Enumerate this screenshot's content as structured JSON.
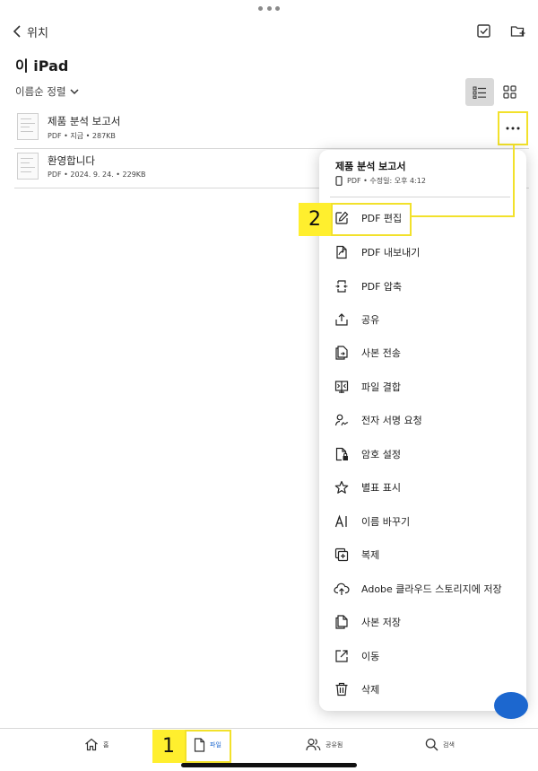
{
  "header": {
    "back_label": "위치",
    "title": "이 iPad",
    "sort_label": "이름순 정렬"
  },
  "files": [
    {
      "name": "제품 분석 보고서",
      "meta": "PDF • 지금 • 287KB"
    },
    {
      "name": "환영합니다",
      "meta": "PDF • 2024. 9. 24. • 229KB"
    }
  ],
  "menu": {
    "file_title": "제품 분석 보고서",
    "file_meta": "PDF • 수정일: 오후 4:12",
    "items": [
      {
        "label": "PDF 편집",
        "icon": "edit-pencil-icon"
      },
      {
        "label": "PDF 내보내기",
        "icon": "export-pdf-icon"
      },
      {
        "label": "PDF 압축",
        "icon": "compress-pdf-icon"
      },
      {
        "label": "공유",
        "icon": "share-icon"
      },
      {
        "label": "사본 전송",
        "icon": "send-copy-icon"
      },
      {
        "label": "파일 결합",
        "icon": "combine-files-icon"
      },
      {
        "label": "전자 서명 요청",
        "icon": "request-signature-icon"
      },
      {
        "label": "암호 설정",
        "icon": "password-lock-icon"
      },
      {
        "label": "별표 표시",
        "icon": "star-icon"
      },
      {
        "label": "이름 바꾸기",
        "icon": "rename-icon"
      },
      {
        "label": "복제",
        "icon": "duplicate-icon"
      },
      {
        "label": "Adobe 클라우드 스토리지에 저장",
        "icon": "cloud-upload-icon"
      },
      {
        "label": "사본 저장",
        "icon": "save-copy-icon"
      },
      {
        "label": "이동",
        "icon": "move-icon"
      },
      {
        "label": "삭제",
        "icon": "trash-icon"
      }
    ]
  },
  "tabs": [
    {
      "label": "홈",
      "icon": "home-icon"
    },
    {
      "label": "파일",
      "icon": "file-icon"
    },
    {
      "label": "공유됨",
      "icon": "shared-users-icon"
    },
    {
      "label": "검색",
      "icon": "search-icon"
    }
  ],
  "annotations": {
    "step1": "1",
    "step2": "2"
  },
  "colors": {
    "accent": "#1c67cf",
    "highlight": "#f2e12b",
    "annotation_fill": "#ffef2e"
  }
}
